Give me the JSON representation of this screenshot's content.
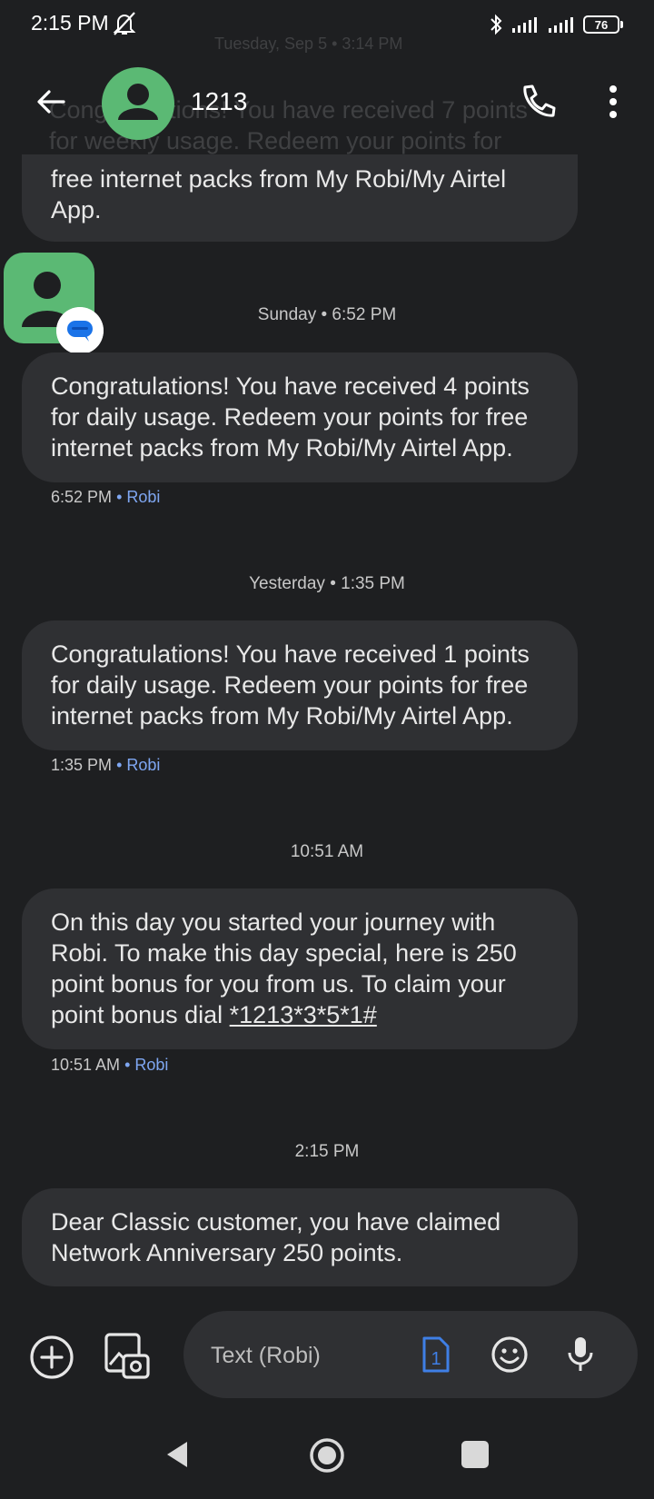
{
  "status_bar": {
    "time": "2:15 PM",
    "battery": "76",
    "icons": [
      "mute-icon",
      "bluetooth-icon",
      "signal-icon",
      "signal-icon",
      "battery-icon"
    ]
  },
  "header": {
    "contact_name": "1213",
    "faded_timestamp": "Tuesday, Sep 5 • 3:14 PM",
    "icons": [
      "back-arrow-icon",
      "contact-avatar-icon",
      "phone-icon",
      "more-vert-icon"
    ]
  },
  "faded_lines": [
    "Congratulations! You have received 7 points",
    "for weekly usage. Redeem your points for"
  ],
  "messages": [
    {
      "text": "free internet packs from My Robi/My Airtel App."
    },
    {
      "divider": "Sunday • 6:52 PM",
      "text": "Congratulations! You have received 4 points for daily usage. Redeem your points for free internet packs from My Robi/My Airtel App.",
      "time": "6:52 PM",
      "sim": "• Robi"
    },
    {
      "divider": "Yesterday • 1:35 PM",
      "text": "Congratulations! You have received 1 points for daily usage. Redeem your points for free internet packs from My Robi/My Airtel App.",
      "time": "1:35 PM",
      "sim": "• Robi"
    },
    {
      "divider": "10:51 AM",
      "text": "On this day  you started your journey with Robi. To make this day special, here is 250 point bonus for you from us. To claim your point bonus dial ",
      "ussd": "*1213*3*5*1#",
      "time": "10:51 AM",
      "sim": "• Robi"
    },
    {
      "divider": "2:15 PM",
      "text": "Dear Classic customer, you have claimed Network Anniversary 250 points."
    }
  ],
  "compose": {
    "placeholder": "Text (Robi)",
    "sim_number": "1",
    "icons": [
      "add-icon",
      "gallery-icon",
      "sim-icon",
      "emoji-icon",
      "mic-icon"
    ]
  },
  "nav": {
    "icons": [
      "nav-back-icon",
      "nav-home-icon",
      "nav-recents-icon"
    ]
  },
  "colors": {
    "background": "#1e1f21",
    "bubble": "#2f3033",
    "avatar": "#5bb974",
    "accent": "#7fa7f2"
  }
}
